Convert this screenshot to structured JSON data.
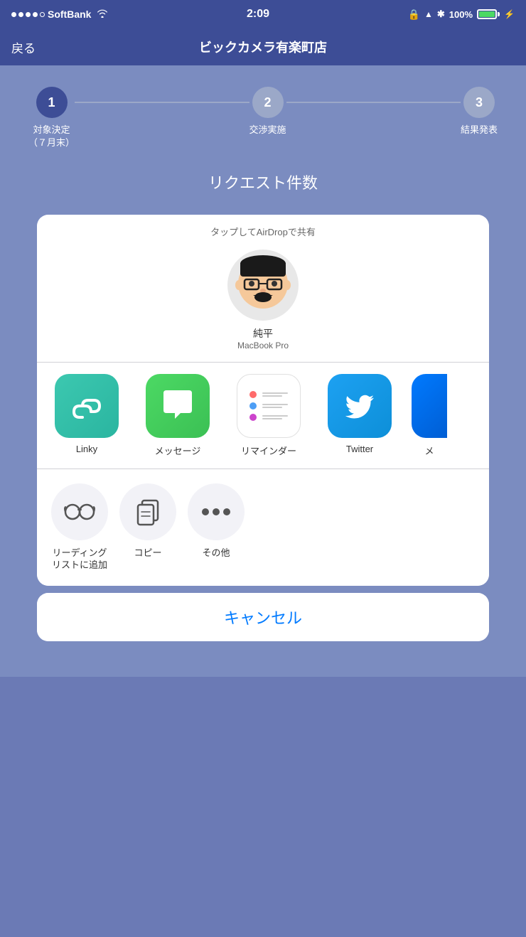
{
  "statusBar": {
    "carrier": "SoftBank",
    "time": "2:09",
    "battery": "100%"
  },
  "navBar": {
    "backLabel": "戻る",
    "title": "ビックカメラ有楽町店"
  },
  "progressSteps": [
    {
      "number": "1",
      "label": "対象決定\n（７月末）",
      "active": true
    },
    {
      "number": "2",
      "label": "交渉実施",
      "active": false
    },
    {
      "number": "3",
      "label": "結果発表",
      "active": false
    }
  ],
  "requestTitle": "リクエスト件数",
  "airdrop": {
    "header": "タップしてAirDropで共有",
    "personName": "純平",
    "personDevice": "MacBook Pro"
  },
  "appIcons": [
    {
      "id": "linky",
      "label": "Linky"
    },
    {
      "id": "messages",
      "label": "メッセージ"
    },
    {
      "id": "reminders",
      "label": "リマインダー"
    },
    {
      "id": "twitter",
      "label": "Twitter"
    }
  ],
  "actions": [
    {
      "id": "reading-list",
      "label": "リーディング\nリストに追加"
    },
    {
      "id": "copy",
      "label": "コピー"
    },
    {
      "id": "more",
      "label": "その他"
    }
  ],
  "cancelButton": "キャンセル"
}
